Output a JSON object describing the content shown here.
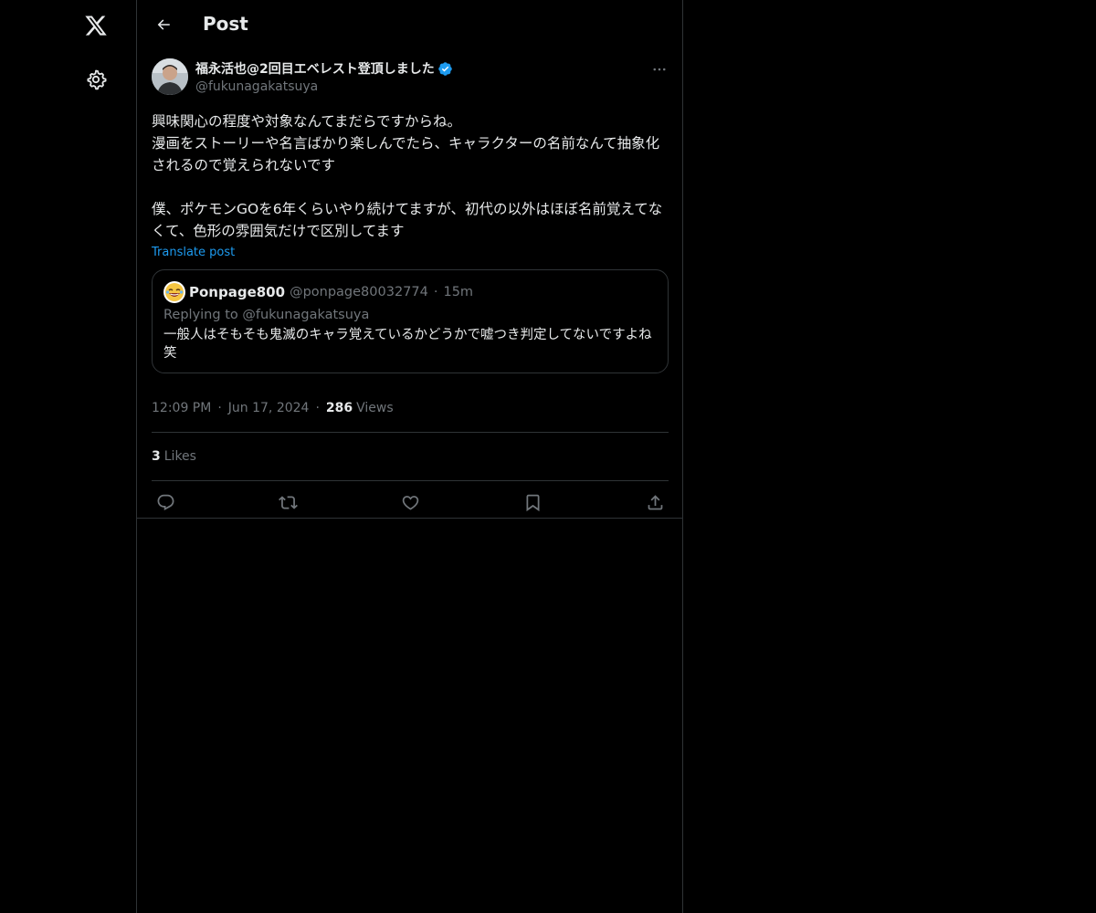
{
  "header": {
    "title": "Post"
  },
  "post": {
    "author": {
      "name": "福永活也@2回目エベレスト登頂しました",
      "handle": "@fukunagakatsuya"
    },
    "body": "興味関心の程度や対象なんてまだらですからね。\n漫画をストーリーや名言ばかり楽しんでたら、キャラクターの名前なんて抽象化されるので覚えられないです\n\n僕、ポケモンGOを6年くらいやり続けてますが、初代の以外はほぼ名前覚えてなくて、色形の雰囲気だけで区別してます",
    "translate_label": "Translate post",
    "quote": {
      "name": "Ponpage800",
      "handle": "@ponpage80032774",
      "dot": "·",
      "time": "15m",
      "replying_to": "Replying to @fukunagakatsuya",
      "text": "一般人はそもそも鬼滅のキャラ覚えているかどうかで嘘つき判定してないですよね笑"
    },
    "meta": {
      "time": "12:09 PM",
      "sep": "·",
      "date": "Jun 17, 2024",
      "views_count": "286",
      "views_label": "Views"
    },
    "likes": {
      "count": "3",
      "label": "Likes"
    }
  },
  "colors": {
    "background": "#000000",
    "text": "#e7e9ea",
    "muted": "#71767b",
    "accent": "#1d9bf0",
    "border": "#2f3336",
    "verified": "#1d9bf0"
  },
  "icons": {
    "logo": "x-logo-icon",
    "settings": "gear-icon",
    "back": "arrow-left-icon",
    "more": "more-horizontal-icon",
    "verified": "verified-badge-icon",
    "reply": "reply-icon",
    "repost": "repost-icon",
    "like": "heart-icon",
    "bookmark": "bookmark-icon",
    "share": "share-icon"
  }
}
